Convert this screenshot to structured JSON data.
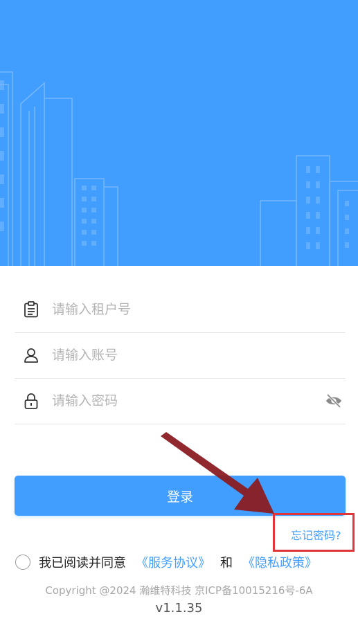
{
  "colors": {
    "primary": "#419efe",
    "annotation_arrow": "#8b1c22",
    "annotation_box": "#e0353b"
  },
  "form": {
    "tenant": {
      "placeholder": "请输入租户号",
      "icon": "clipboard-icon"
    },
    "account": {
      "placeholder": "请输入账号",
      "icon": "user-icon"
    },
    "password": {
      "placeholder": "请输入密码",
      "icon": "lock-icon",
      "toggle_icon": "eye-off-icon"
    }
  },
  "login_label": "登录",
  "forgot_label": "忘记密码?",
  "agreement": {
    "prefix": "我已阅读并同意",
    "service_link": "《服务协议》",
    "and": "和",
    "privacy_link": "《隐私政策》"
  },
  "footer": {
    "copyright": "Copyright @2024 瀚维特科技 京ICP备10015216号-6A",
    "version": "v1.1.35"
  }
}
